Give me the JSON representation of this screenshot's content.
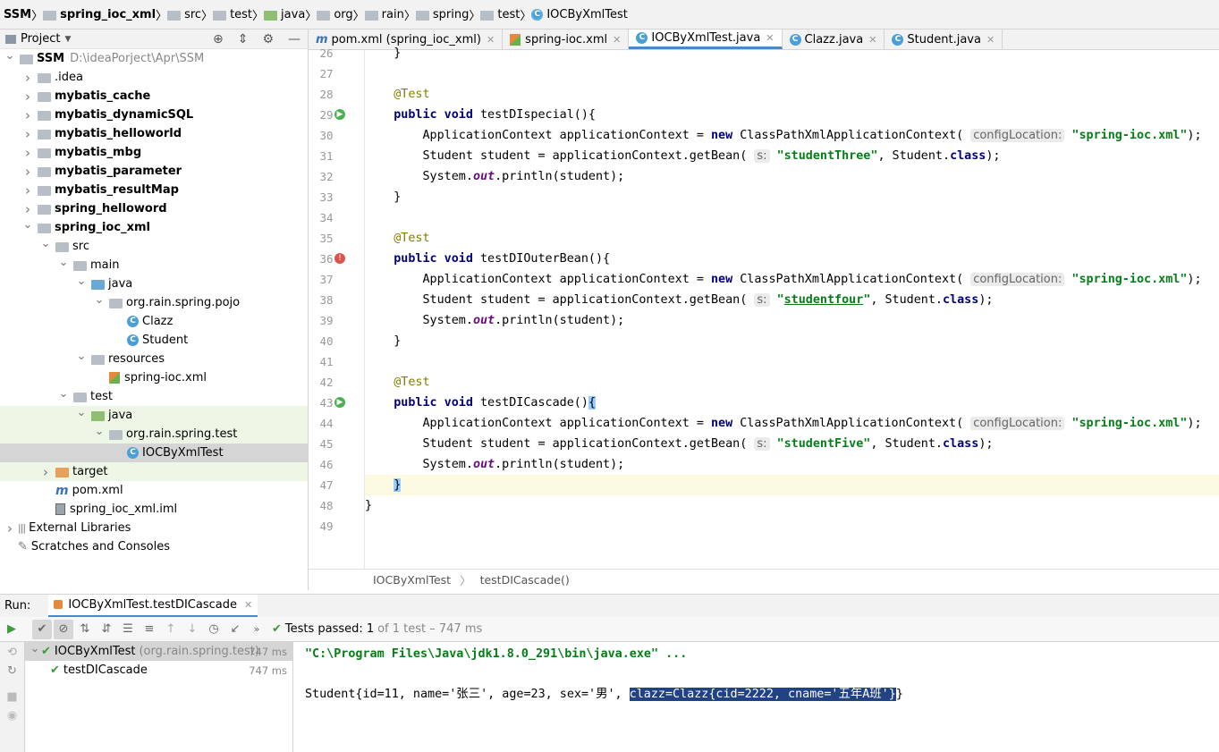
{
  "breadcrumb": [
    "SSM",
    "spring_ioc_xml",
    "src",
    "test",
    "java",
    "org",
    "rain",
    "spring",
    "test",
    "IOCByXmlTest"
  ],
  "project_panel": {
    "title": "Project",
    "tree": [
      {
        "label": "SSM",
        "extra": "D:\\ideaPorject\\Apr\\SSM",
        "depth": 0,
        "arrow": "open",
        "icon": "folder",
        "bold": true
      },
      {
        "label": ".idea",
        "depth": 1,
        "arrow": "closed",
        "icon": "folder"
      },
      {
        "label": "mybatis_cache",
        "depth": 1,
        "arrow": "closed",
        "icon": "folder",
        "bold": true
      },
      {
        "label": "mybatis_dynamicSQL",
        "depth": 1,
        "arrow": "closed",
        "icon": "folder",
        "bold": true
      },
      {
        "label": "mybatis_helloworld",
        "depth": 1,
        "arrow": "closed",
        "icon": "folder",
        "bold": true
      },
      {
        "label": "mybatis_mbg",
        "depth": 1,
        "arrow": "closed",
        "icon": "folder",
        "bold": true
      },
      {
        "label": "mybatis_parameter",
        "depth": 1,
        "arrow": "closed",
        "icon": "folder",
        "bold": true
      },
      {
        "label": "mybatis_resultMap",
        "depth": 1,
        "arrow": "closed",
        "icon": "folder",
        "bold": true
      },
      {
        "label": "spring_helloword",
        "depth": 1,
        "arrow": "closed",
        "icon": "folder",
        "bold": true
      },
      {
        "label": "spring_ioc_xml",
        "depth": 1,
        "arrow": "open",
        "icon": "folder",
        "bold": true
      },
      {
        "label": "src",
        "depth": 2,
        "arrow": "open",
        "icon": "folder"
      },
      {
        "label": "main",
        "depth": 3,
        "arrow": "open",
        "icon": "folder"
      },
      {
        "label": "java",
        "depth": 4,
        "arrow": "open",
        "icon": "folder-blue"
      },
      {
        "label": "org.rain.spring.pojo",
        "depth": 5,
        "arrow": "open",
        "icon": "folder"
      },
      {
        "label": "Clazz",
        "depth": 6,
        "arrow": "none",
        "icon": "class"
      },
      {
        "label": "Student",
        "depth": 6,
        "arrow": "none",
        "icon": "class"
      },
      {
        "label": "resources",
        "depth": 4,
        "arrow": "open",
        "icon": "folder"
      },
      {
        "label": "spring-ioc.xml",
        "depth": 5,
        "arrow": "none",
        "icon": "xml"
      },
      {
        "label": "test",
        "depth": 3,
        "arrow": "open",
        "icon": "folder"
      },
      {
        "label": "java",
        "depth": 4,
        "arrow": "open",
        "icon": "folder-green",
        "highlight": true
      },
      {
        "label": "org.rain.spring.test",
        "depth": 5,
        "arrow": "open",
        "icon": "folder",
        "highlight": true
      },
      {
        "label": "IOCByXmlTest",
        "depth": 6,
        "arrow": "none",
        "icon": "class",
        "selected": true
      },
      {
        "label": "target",
        "depth": 2,
        "arrow": "closed",
        "icon": "folder-orange",
        "highlight": true
      },
      {
        "label": "pom.xml",
        "depth": 2,
        "arrow": "none",
        "icon": "maven"
      },
      {
        "label": "spring_ioc_xml.iml",
        "depth": 2,
        "arrow": "none",
        "icon": "iml"
      },
      {
        "label": "External Libraries",
        "depth": 0,
        "arrow": "closed",
        "icon": "library"
      },
      {
        "label": "Scratches and Consoles",
        "depth": 0,
        "arrow": "none",
        "icon": "scratch"
      }
    ]
  },
  "tabs": [
    {
      "label": "pom.xml (spring_ioc_xml)",
      "icon": "m",
      "active": false
    },
    {
      "label": "spring-ioc.xml",
      "icon": "xml",
      "active": false
    },
    {
      "label": "IOCByXmlTest.java",
      "icon": "class",
      "active": true
    },
    {
      "label": "Clazz.java",
      "icon": "class",
      "active": false
    },
    {
      "label": "Student.java",
      "icon": "class",
      "active": false
    }
  ],
  "code": {
    "lines": [
      {
        "n": "26",
        "html": "    }"
      },
      {
        "n": "27",
        "html": ""
      },
      {
        "n": "28",
        "html": "    <span class='an'>@Test</span>"
      },
      {
        "n": "29",
        "html": "    <span class='kw'>public void</span> testDIspecial(){",
        "gutter": "run"
      },
      {
        "n": "30",
        "html": "        ApplicationContext applicationContext = <span class='kw'>new</span> ClassPathXmlApplicationContext( <span class='hint'>configLocation:</span> <span class='st'>\"spring-ioc.xml\"</span>);"
      },
      {
        "n": "31",
        "html": "        Student student = applicationContext.getBean( <span class='hint'>s:</span> <span class='st'>\"studentThree\"</span>, Student.<span class='kw'>class</span>);"
      },
      {
        "n": "32",
        "html": "        System.<span class='it'>out</span>.println(student);"
      },
      {
        "n": "33",
        "html": "    }"
      },
      {
        "n": "34",
        "html": ""
      },
      {
        "n": "35",
        "html": "    <span class='an'>@Test</span>"
      },
      {
        "n": "36",
        "html": "    <span class='kw'>public void</span> testDIOuterBean(){",
        "gutter": "err"
      },
      {
        "n": "37",
        "html": "        ApplicationContext applicationContext = <span class='kw'>new</span> ClassPathXmlApplicationContext( <span class='hint'>configLocation:</span> <span class='st'>\"spring-ioc.xml\"</span>);"
      },
      {
        "n": "38",
        "html": "        Student student = applicationContext.getBean( <span class='hint'>s:</span> <span class='st'>\"<u>studentfour</u>\"</span>, Student.<span class='kw'>class</span>);"
      },
      {
        "n": "39",
        "html": "        System.<span class='it'>out</span>.println(student);"
      },
      {
        "n": "40",
        "html": "    }"
      },
      {
        "n": "41",
        "html": ""
      },
      {
        "n": "42",
        "html": "    <span class='an'>@Test</span>"
      },
      {
        "n": "43",
        "html": "    <span class='kw'>public void</span> testDICascade()<span class='brk'>{</span>",
        "gutter": "run"
      },
      {
        "n": "44",
        "html": "        ApplicationContext applicationContext = <span class='kw'>new</span> ClassPathXmlApplicationContext( <span class='hint'>configLocation:</span> <span class='st'>\"spring-ioc.xml\"</span>);"
      },
      {
        "n": "45",
        "html": "        Student student = applicationContext.getBean( <span class='hint'>s:</span> <span class='st'>\"studentFive\"</span>, Student.<span class='kw'>class</span>);"
      },
      {
        "n": "46",
        "html": "        System.<span class='it'>out</span>.println(student);"
      },
      {
        "n": "47",
        "html": "    <span class='brk'>}</span>",
        "current": true
      },
      {
        "n": "48",
        "html": "}"
      },
      {
        "n": "49",
        "html": ""
      }
    ]
  },
  "editor_breadcrumb": [
    "IOCByXmlTest",
    "testDICascade()"
  ],
  "run": {
    "label": "Run:",
    "tab": "IOCByXmlTest.testDICascade",
    "status_prefix": "Tests passed:",
    "status_count": "1",
    "status_suffix": "of 1 test – 747 ms",
    "tree": [
      {
        "label": "IOCByXmlTest",
        "pkg": "(org.rain.spring.test)",
        "ms": "747 ms",
        "depth": 0,
        "selected": true
      },
      {
        "label": "testDICascade",
        "pkg": "",
        "ms": "747 ms",
        "depth": 1,
        "selected": false
      }
    ],
    "console": {
      "cmd": "\"C:\\Program Files\\Java\\jdk1.8.0_291\\bin\\java.exe\" ...",
      "out_prefix": "Student{id=11, name='张三', age=23, sex='男', ",
      "out_selected": "clazz=Clazz{cid=2222, cname='五年A班'}",
      "out_suffix": "}"
    }
  }
}
